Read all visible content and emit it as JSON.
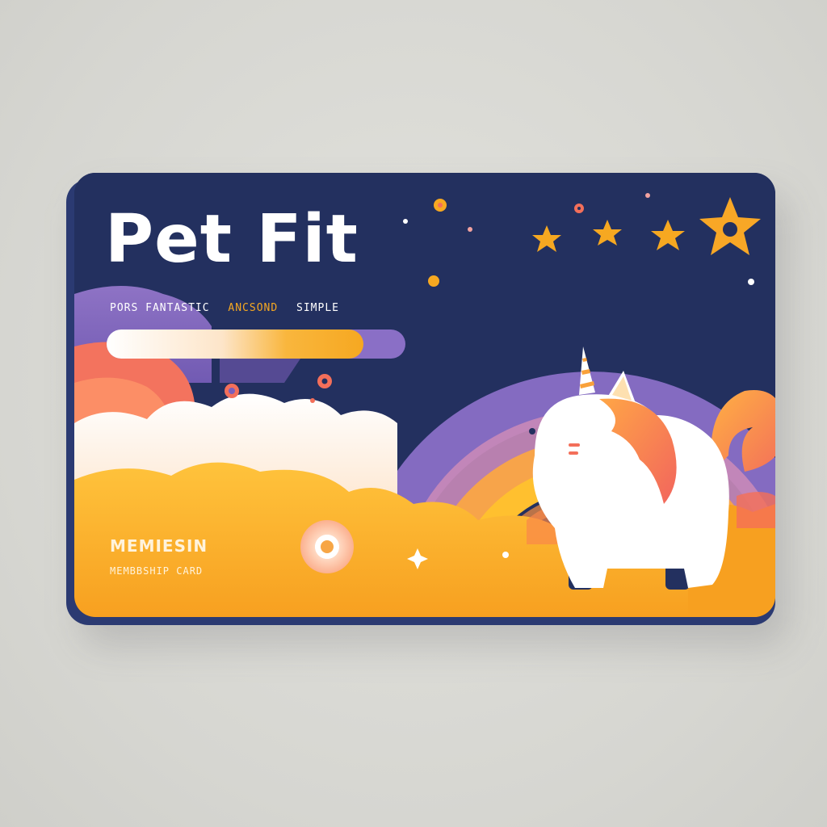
{
  "card": {
    "title": "Pet Fit",
    "tagline": {
      "part1": "PORS FANTASTIC",
      "part2": "ANCSOND",
      "part3": "SIMPLE"
    },
    "label_main": "MEMIESIN",
    "label_sub": "MEMBBSHIP CARD"
  },
  "colors": {
    "navy": "#23305f",
    "orange": "#f6a821",
    "coral": "#f3735e",
    "purple": "#8a6fc6",
    "cream": "#fff3dc"
  },
  "icons": [
    "star-icon",
    "unicorn-cat-illustration",
    "target-icon",
    "sparkle-icon"
  ]
}
